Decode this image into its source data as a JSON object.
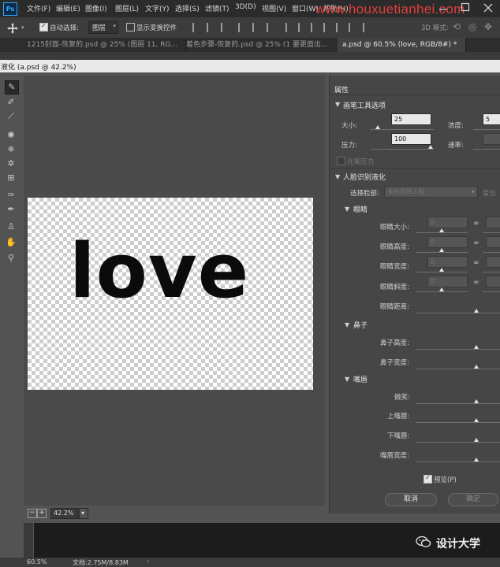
{
  "menubar": {
    "logo": "Ps",
    "items": [
      "文件(F)",
      "编辑(E)",
      "图像(I)",
      "图层(L)",
      "文字(Y)",
      "选择(S)",
      "滤镜(T)",
      "3D(D)",
      "视图(V)",
      "窗口(W)",
      "帮助(H)"
    ],
    "watermark": "www.houxuetianhei.com"
  },
  "optionsbar": {
    "auto_select_label": "自动选择:",
    "auto_select_value": "图层",
    "show_transform_label": "显示变换控件",
    "mode_label": "3D 模式:"
  },
  "tabs": [
    "1215封面-恢复的.psd @ 25% (图层 11, RG...",
    "着色步骤-恢复的.psd @ 25% (1 要更面出...",
    "a.psd @ 60.5% (love, RGB/8#) *"
  ],
  "liquify": {
    "window_title": "液化 (a.psd @ 42.2%)",
    "canvas_text": "love",
    "zoom": "42.2%"
  },
  "panel": {
    "title": "属性",
    "brush_section": "画笔工具选项",
    "size_label": "大小:",
    "size_value": "25",
    "density_label": "浓度:",
    "density_value": "5",
    "pressure_label": "压力:",
    "pressure_value": "100",
    "rate_label": "速率:",
    "stylus_label": "光笔压力",
    "face_section": "人脸识别液化",
    "select_face_label": "选择脸部:",
    "select_face_value": "未检测到人脸",
    "reset_label": "复位",
    "eyes_section": "眼睛",
    "eye_size": "眼睛大小:",
    "eye_height": "眼睛高度:",
    "eye_width": "眼睛宽度:",
    "eye_tilt": "眼睛斜度:",
    "eye_distance": "眼睛距离:",
    "nose_section": "鼻子",
    "nose_height": "鼻子高度:",
    "nose_width": "鼻子宽度:",
    "mouth_section": "嘴唇",
    "smile": "微笑:",
    "upper_lip": "上嘴唇:",
    "lower_lip": "下嘴唇:",
    "mouth_width": "嘴唇宽度:",
    "eye_field_value": "0",
    "preview_label": "预览(P)",
    "cancel_label": "取消",
    "ok_label": "确定"
  },
  "statusbar": {
    "zoom": "60.5%",
    "doc": "文档:2.75M/8.83M"
  },
  "wechat": {
    "account": "设计大学"
  }
}
